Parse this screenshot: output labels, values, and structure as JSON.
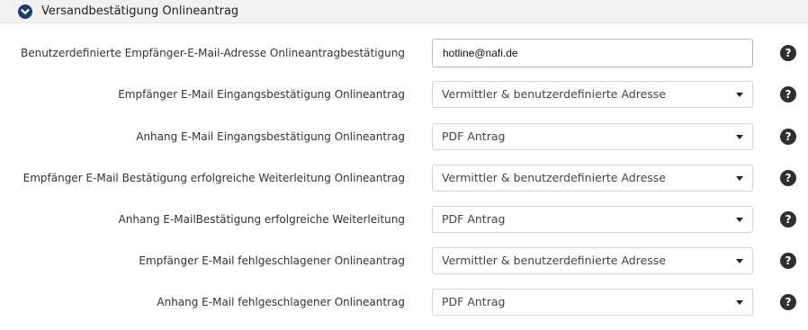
{
  "section": {
    "title": "Versandbestätigung Onlineantrag",
    "toggle_icon": "chevron-down-icon"
  },
  "colors": {
    "accent": "#1c3d6b",
    "header_bg": "#f1f1f1",
    "help_icon": "#2f2f2f"
  },
  "fields": [
    {
      "label": "Benutzerdefinierte Empfänger-E-Mail-Adresse Onlineantragbestätigung",
      "type": "text",
      "value": "hotline@nafi.de"
    },
    {
      "label": "Empfänger E-Mail Eingangsbestätigung Onlineantrag",
      "type": "select",
      "value": "Vermittler & benutzerdefinierte Adresse"
    },
    {
      "label": "Anhang E-Mail Eingangsbestätigung Onlineantrag",
      "type": "select",
      "value": "PDF Antrag"
    },
    {
      "label": "Empfänger E-Mail Bestätigung erfolgreiche Weiterleitung Onlineantrag",
      "type": "select",
      "value": "Vermittler & benutzerdefinierte Adresse"
    },
    {
      "label": "Anhang E-MailBestätigung erfolgreiche Weiterleitung",
      "type": "select",
      "value": "PDF Antrag"
    },
    {
      "label": "Empfänger E-Mail fehlgeschlagener Onlineantrag",
      "type": "select",
      "value": "Vermittler & benutzerdefinierte Adresse"
    },
    {
      "label": "Anhang E-Mail fehlgeschlagener Onlineantrag",
      "type": "select",
      "value": "PDF Antrag"
    }
  ],
  "help": {
    "glyph": "?",
    "icon": "help-icon"
  }
}
